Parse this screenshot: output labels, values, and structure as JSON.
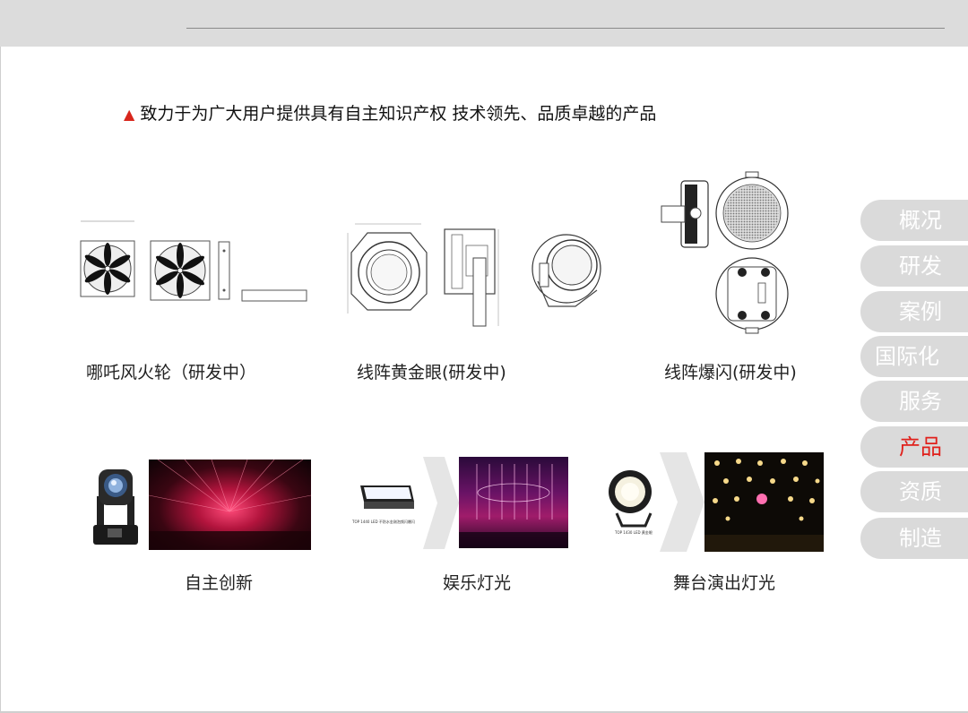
{
  "headline": "致力于为广大用户提供具有自主知识产权 技术领先、品质卓越的产品",
  "products_rd": [
    {
      "caption": "哪吒风火轮（研发中）"
    },
    {
      "caption": "线阵黄金眼(研发中)"
    },
    {
      "caption": "线阵爆闪(研发中)"
    }
  ],
  "categories": [
    {
      "caption": "自主创新"
    },
    {
      "caption": "娱乐灯光",
      "product_tag": "TOP 1440 LED 不防水金刚泡频闪爆闪"
    },
    {
      "caption": "舞台演出灯光",
      "product_tag": "TOP 1430 LED 黄金眼"
    }
  ],
  "nav": {
    "items": [
      "概况",
      "研发",
      "案例",
      "国际化",
      "服务",
      "产品",
      "资质",
      "制造"
    ],
    "active": "产品",
    "active_color": "#e0201b"
  },
  "colors": {
    "accent": "#d8261c",
    "nav_bg": "#dadada",
    "top_bar": "#dcdcdc"
  }
}
